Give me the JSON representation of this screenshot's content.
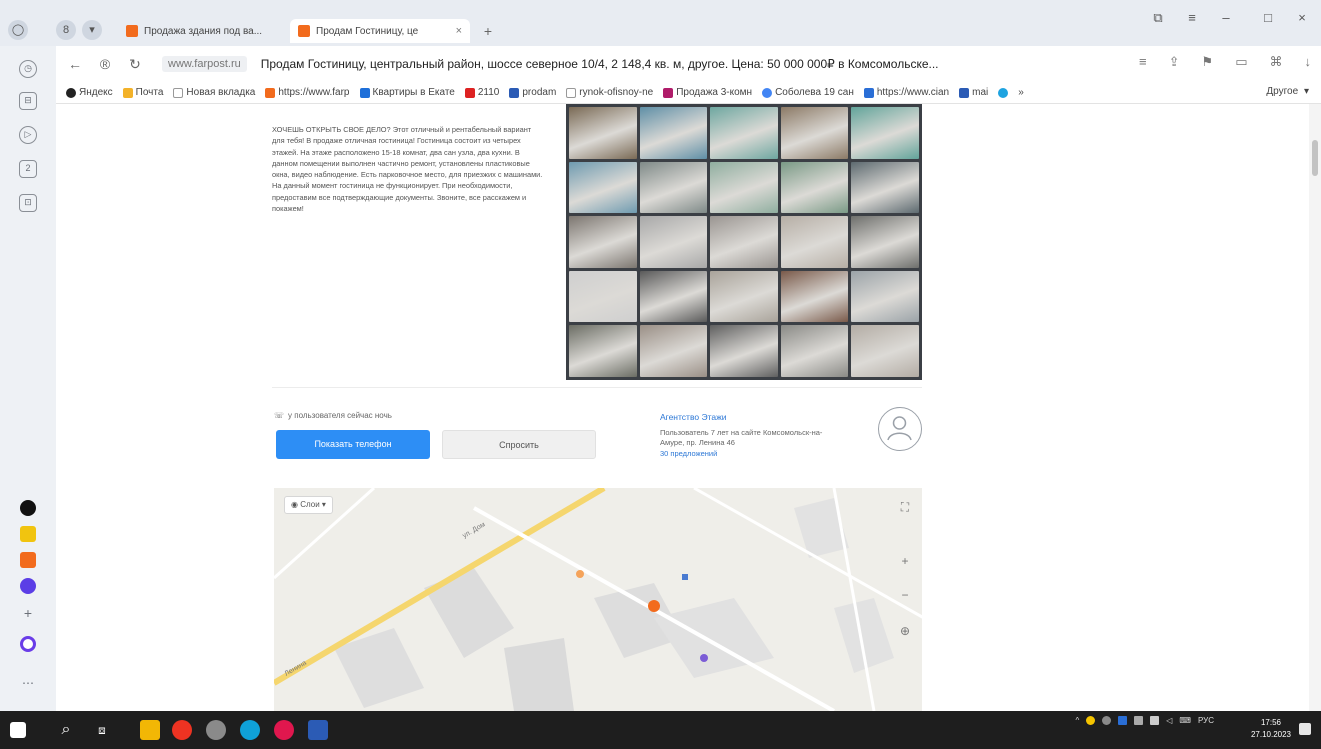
{
  "browser": {
    "tabs": [
      {
        "title": "Продажа здания под ва...",
        "active": false
      },
      {
        "title": "Продам Гостиницу, це",
        "active": true
      }
    ],
    "new_tab": "+",
    "address": {
      "domain": "www.farpost.ru",
      "page_title": "Продам Гостиницу, центральный район, шоссе северное 10/4, 2 148,4 кв. м, другое. Цена: 50 000 000₽ в Комсомольске..."
    },
    "bookmarks": [
      "Яндекс",
      "Почта",
      "Новая вкладка",
      "https://www.farp",
      "Квартиры в Екате",
      "2110",
      "prodam",
      "rynok-ofisnoy-ne",
      "Продажа 3-комн",
      "Соболева 19 сан",
      "https://www.cian",
      "mai"
    ],
    "bookmarks_other": "Другое"
  },
  "listing": {
    "description": "ХОЧЕШЬ ОТКРЫТЬ СВОЕ ДЕЛО? Этот отличный и рентабельный вариант для тебя! В продаже отличная гостиница! Гостиница состоит из четырех этажей. На этаже расположено 15-18 комнат, два сан узла, два кухни. В данном помещении выполнен частично ремонт, установлены пластиковые окна, видео наблюдение. Есть парковочное место, для приезжих с машинами. На данный момент гостиница не функционирует. При необходимости, предоставим все подтверждающие документы. Звоните, все расскажем и покажем!",
    "owner_note": "у пользователя сейчас ночь",
    "show_phone_button": "Показать телефон",
    "ask_button": "Спросить",
    "seller": {
      "name": "Агентство Этажи",
      "info": "Пользователь 7 лет на сайте Комсомольск-на-Амуре, пр. Ленина 46",
      "ads": "30 предложений"
    },
    "gallery_colors": [
      "#7a6a55",
      "#5f8fa6",
      "#6ea7a0",
      "#8c7a66",
      "#62a49a",
      "#6f9bb0",
      "#7f8a88",
      "#8fae9f",
      "#7a9a86",
      "#5d6a70",
      "#7c7670",
      "#a8a8a8",
      "#9a9591",
      "#b6aea5",
      "#6e6f6c",
      "#cfcfcf",
      "#5a5a5a",
      "#a9a39a",
      "#7a5a4a",
      "#9ba3a8",
      "#6b6d64",
      "#9a8f86",
      "#5f5f5f",
      "#8a8a86",
      "#b3aca4"
    ]
  },
  "map": {
    "layer_label": "Слои",
    "street_labels": [
      "ул. Дом",
      "Ленина"
    ]
  },
  "taskbar": {
    "lang": "РУС",
    "time": "17:56",
    "date": "27.10.2023"
  }
}
